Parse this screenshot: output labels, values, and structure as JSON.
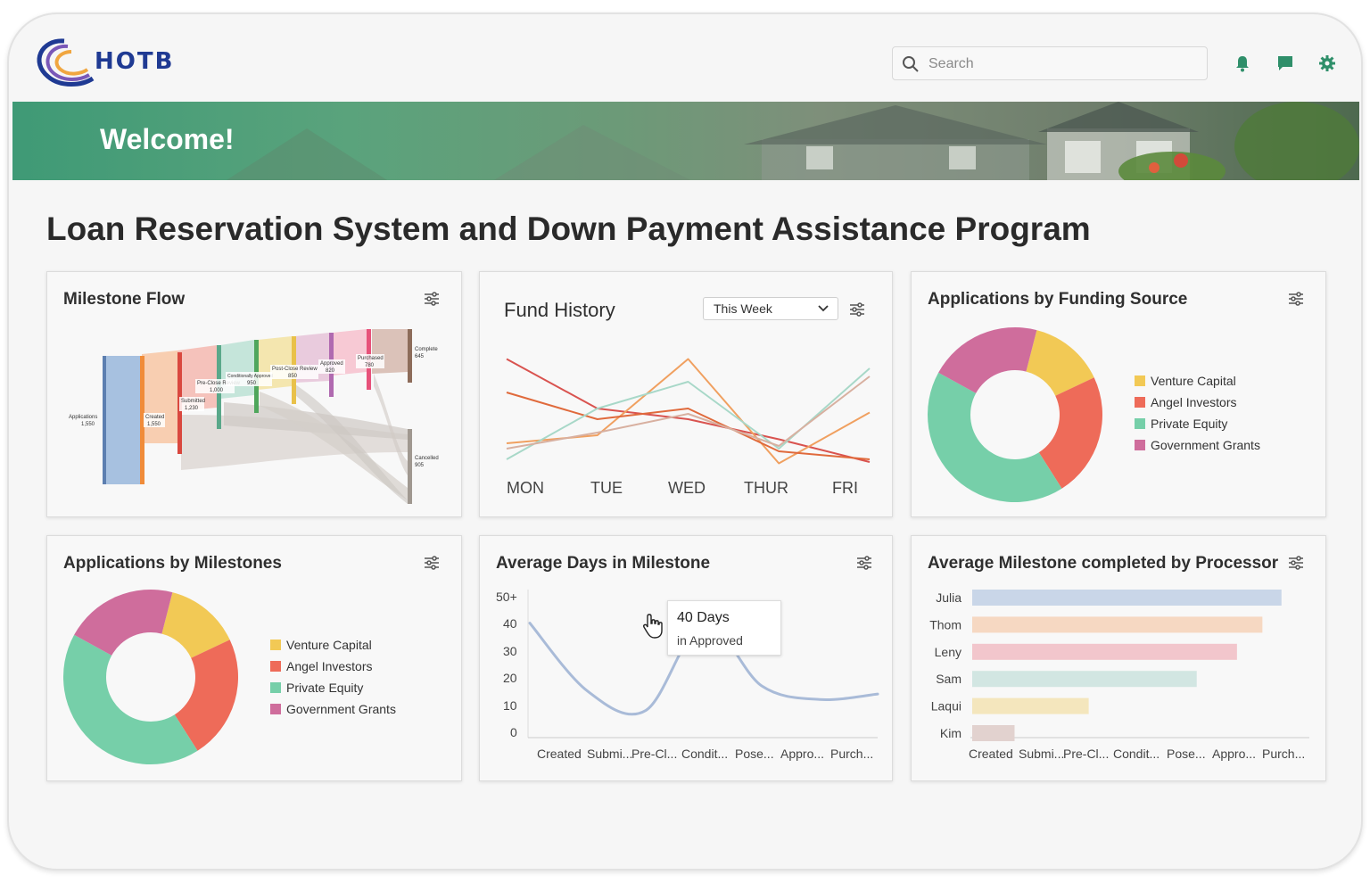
{
  "header": {
    "logo_text": "HOTB",
    "search": {
      "placeholder": "Search"
    },
    "icons": [
      "bell-icon",
      "chat-icon",
      "gear-icon"
    ]
  },
  "banner": {
    "welcome": "Welcome!"
  },
  "page": {
    "title": "Loan Reservation System and Down Payment Assistance Program"
  },
  "colors": {
    "brand_green": "#3f9a76",
    "venture_capital": "#f2c955",
    "angel_investors": "#ee6b59",
    "private_equity": "#76cfa9",
    "government_grants": "#cf6d9c"
  },
  "milestone_flow": {
    "title": "Milestone Flow",
    "nodes": [
      {
        "label": "Applications",
        "value": "1,550"
      },
      {
        "label": "Created",
        "value": "1,550"
      },
      {
        "label": "Submitted",
        "value": "1,230"
      },
      {
        "label": "Pre-Close Review",
        "value": "1,000"
      },
      {
        "label": "Conditionally Approved",
        "value": "950"
      },
      {
        "label": "Post-Close Review",
        "value": "850"
      },
      {
        "label": "Approved",
        "value": "820"
      },
      {
        "label": "Purchased",
        "value": "780"
      },
      {
        "label": "Complete",
        "value": "645"
      },
      {
        "label": "Cancelled",
        "value": "905"
      }
    ]
  },
  "fund_history": {
    "title": "Fund History",
    "range_select": "This Week",
    "days": [
      "MON",
      "TUE",
      "WED",
      "THUR",
      "FRI"
    ]
  },
  "funding_source": {
    "title": "Applications by Funding Source",
    "legend": [
      "Venture Capital",
      "Angel Investors",
      "Private Equity",
      "Government Grants"
    ]
  },
  "by_milestones": {
    "title": "Applications by Milestones",
    "legend": [
      "Venture Capital",
      "Angel Investors",
      "Private Equity",
      "Government Grants"
    ]
  },
  "avg_days": {
    "title": "Average Days in Milestone",
    "yticks": [
      "50+",
      "40",
      "30",
      "20",
      "10",
      "0"
    ],
    "xticks": [
      "Created",
      "Submi...",
      "Pre-Cl...",
      "Condit...",
      "Pose...",
      "Appro...",
      "Purch..."
    ],
    "tooltip": {
      "value": "40 Days",
      "label": "in Approved"
    }
  },
  "processor": {
    "title": "Average Milestone completed by Processor",
    "xticks": [
      "Created",
      "Submi...",
      "Pre-Cl...",
      "Condit...",
      "Pose...",
      "Appro...",
      "Purch..."
    ]
  },
  "chart_data": [
    {
      "type": "line",
      "categories": [
        "MON",
        "TUE",
        "WED",
        "THUR",
        "FRI"
      ],
      "ylim": [
        0,
        100
      ],
      "series": [
        {
          "color": "#d9534f",
          "values": [
            85,
            48,
            40,
            25,
            8
          ]
        },
        {
          "color": "#f0a060",
          "values": [
            22,
            28,
            85,
            7,
            45
          ]
        },
        {
          "color": "#e06a3c",
          "values": [
            60,
            40,
            48,
            16,
            10
          ]
        },
        {
          "color": "#a8d8c8",
          "values": [
            10,
            48,
            68,
            18,
            78
          ]
        },
        {
          "color": "#d8b0a0",
          "values": [
            18,
            30,
            44,
            20,
            72
          ]
        }
      ]
    },
    {
      "type": "pie",
      "labels": [
        "Venture Capital",
        "Angel Investors",
        "Private Equity",
        "Government Grants"
      ],
      "values": [
        14,
        23,
        42,
        21
      ]
    },
    {
      "type": "pie",
      "labels": [
        "Venture Capital",
        "Angel Investors",
        "Private Equity",
        "Government Grants"
      ],
      "values": [
        14,
        23,
        42,
        21
      ]
    },
    {
      "type": "line",
      "categories": [
        "Created",
        "Submi...",
        "Pre-Cl...",
        "Condit...",
        "Pose...",
        "Appro...",
        "Purch..."
      ],
      "ylim": [
        0,
        50
      ],
      "values": [
        40,
        15,
        8,
        40,
        17,
        12,
        14
      ]
    },
    {
      "type": "bar",
      "orientation": "horizontal",
      "categories": [
        "Julia",
        "Thom",
        "Leny",
        "Sam",
        "Laqui",
        "Kim"
      ],
      "values": [
        7.3,
        6.85,
        6.25,
        5.3,
        2.75,
        1.0
      ],
      "colors": [
        "#c9d6e8",
        "#f6d8c2",
        "#f2c6cc",
        "#d2e6e2",
        "#f4e6bd",
        "#e2d2cf"
      ]
    }
  ]
}
